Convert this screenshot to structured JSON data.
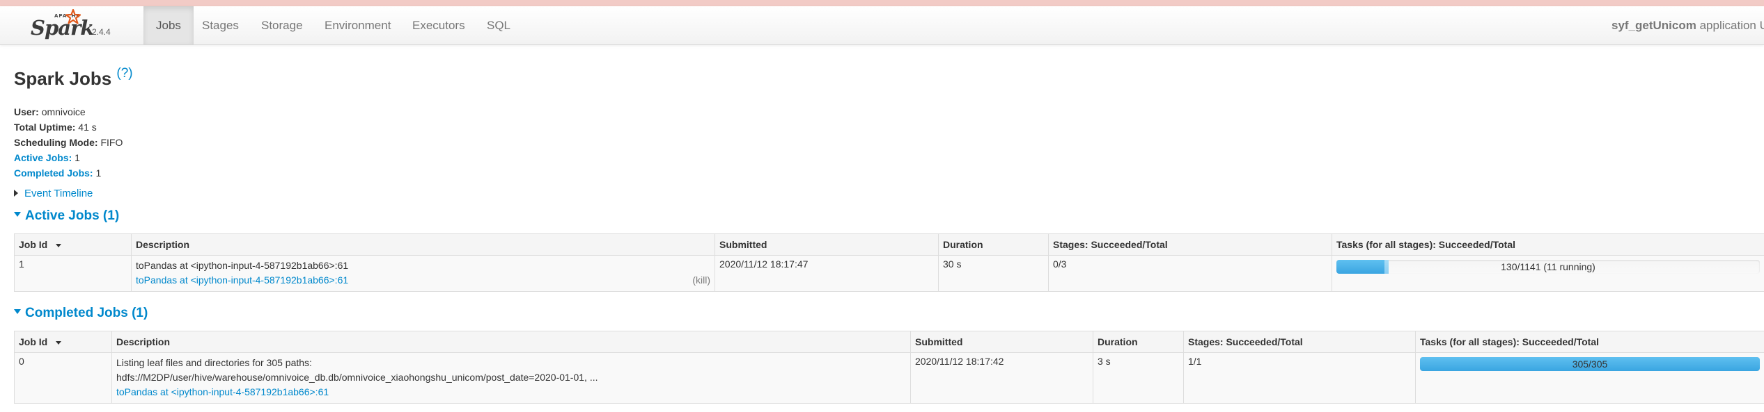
{
  "nav": {
    "version": "2.4.4",
    "tabs": [
      "Jobs",
      "Stages",
      "Storage",
      "Environment",
      "Executors",
      "SQL"
    ],
    "app_name": "syf_getUnicom",
    "app_suffix": " application UI"
  },
  "page": {
    "title": "Spark Jobs",
    "help": "(?)"
  },
  "summary": {
    "user_label": "User:",
    "user": "omnivoice",
    "uptime_label": "Total Uptime:",
    "uptime": "41 s",
    "sched_label": "Scheduling Mode:",
    "sched": "FIFO",
    "active_label": "Active Jobs:",
    "active": "1",
    "completed_label": "Completed Jobs:",
    "completed": "1"
  },
  "event_timeline": "Event Timeline",
  "active_jobs": {
    "title": "Active Jobs (1)",
    "headers": [
      "Job Id",
      "Description",
      "Submitted",
      "Duration",
      "Stages: Succeeded/Total",
      "Tasks (for all stages): Succeeded/Total"
    ],
    "rows": [
      {
        "job_id": "1",
        "desc_line1": "toPandas at <ipython-input-4-587192b1ab66>:61",
        "desc_link": "toPandas at <ipython-input-4-587192b1ab66>:61",
        "kill": "(kill)",
        "submitted": "2020/11/12 18:17:47",
        "duration": "30 s",
        "stages": "0/3",
        "tasks_label": "130/1141 (11 running)",
        "tasks_succeeded": 130,
        "tasks_running": 11,
        "tasks_total": 1141
      }
    ]
  },
  "completed_jobs": {
    "title": "Completed Jobs (1)",
    "headers": [
      "Job Id",
      "Description",
      "Submitted",
      "Duration",
      "Stages: Succeeded/Total",
      "Tasks (for all stages): Succeeded/Total"
    ],
    "rows": [
      {
        "job_id": "0",
        "desc_line1": "Listing leaf files and directories for 305 paths:",
        "desc_line2": "hdfs://M2DP/user/hive/warehouse/omnivoice_db.db/omnivoice_xiaohongshu_unicom/post_date=2020-01-01, ...",
        "desc_link": "toPandas at <ipython-input-4-587192b1ab66>:61",
        "submitted": "2020/11/12 18:17:42",
        "duration": "3 s",
        "stages": "1/1",
        "tasks_label": "305/305",
        "tasks_succeeded": 305,
        "tasks_running": 0,
        "tasks_total": 305
      }
    ]
  }
}
